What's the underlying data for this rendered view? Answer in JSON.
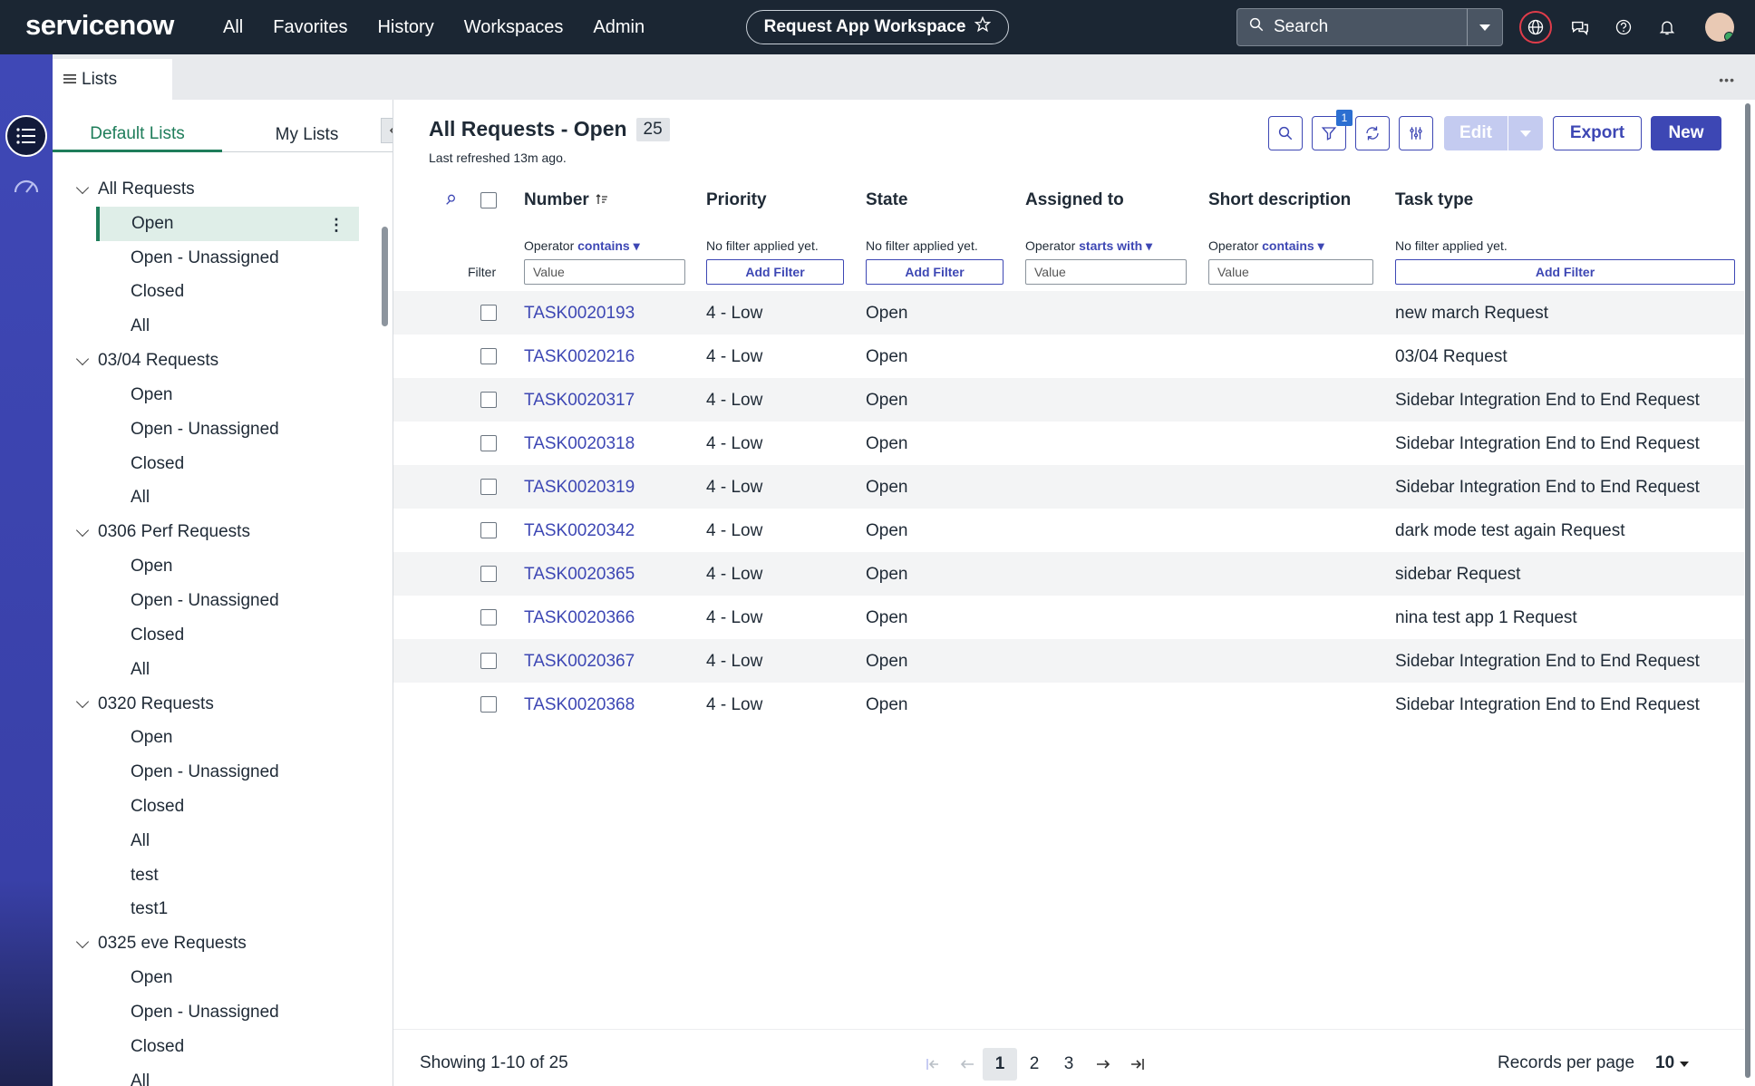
{
  "topbar": {
    "logo": "servicenow",
    "nav": [
      "All",
      "Favorites",
      "History",
      "Workspaces",
      "Admin"
    ],
    "workspace_title": "Request App Workspace",
    "search_placeholder": "Search"
  },
  "tabstrip": {
    "tab_label": "Lists"
  },
  "sidebar": {
    "tabs": [
      "Default Lists",
      "My Lists"
    ],
    "groups": [
      {
        "title": "All Requests",
        "items": [
          "Open",
          "Open - Unassigned",
          "Closed",
          "All"
        ],
        "selected": 0
      },
      {
        "title": "03/04 Requests",
        "items": [
          "Open",
          "Open - Unassigned",
          "Closed",
          "All"
        ]
      },
      {
        "title": "0306 Perf Requests",
        "items": [
          "Open",
          "Open - Unassigned",
          "Closed",
          "All"
        ]
      },
      {
        "title": "0320 Requests",
        "items": [
          "Open",
          "Open - Unassigned",
          "Closed",
          "All",
          "test",
          "test1"
        ]
      },
      {
        "title": "0325 eve Requests",
        "items": [
          "Open",
          "Open - Unassigned",
          "Closed",
          "All"
        ]
      }
    ]
  },
  "list": {
    "title": "All Requests - Open",
    "count": "25",
    "refreshed": "Last refreshed 13m ago.",
    "filter_badge": "1",
    "buttons": {
      "edit": "Edit",
      "export": "Export",
      "new": "New"
    },
    "columns": [
      "Number",
      "Priority",
      "State",
      "Assigned to",
      "Short description",
      "Task type"
    ],
    "filter_label": "Filter",
    "operators": {
      "number": {
        "prefix": "Operator",
        "op": "contains"
      },
      "assigned": {
        "prefix": "Operator",
        "op": "starts with"
      },
      "short_desc": {
        "prefix": "Operator",
        "op": "contains"
      }
    },
    "no_filter": "No filter applied yet.",
    "value_placeholder": "Value",
    "add_filter": "Add Filter",
    "rows": [
      {
        "number": "TASK0020193",
        "priority": "4 - Low",
        "state": "Open",
        "task_type": "new march Request"
      },
      {
        "number": "TASK0020216",
        "priority": "4 - Low",
        "state": "Open",
        "task_type": "03/04 Request"
      },
      {
        "number": "TASK0020317",
        "priority": "4 - Low",
        "state": "Open",
        "task_type": "Sidebar Integration End to End Request"
      },
      {
        "number": "TASK0020318",
        "priority": "4 - Low",
        "state": "Open",
        "task_type": "Sidebar Integration End to End Request"
      },
      {
        "number": "TASK0020319",
        "priority": "4 - Low",
        "state": "Open",
        "task_type": "Sidebar Integration End to End Request"
      },
      {
        "number": "TASK0020342",
        "priority": "4 - Low",
        "state": "Open",
        "task_type": "dark mode test again Request"
      },
      {
        "number": "TASK0020365",
        "priority": "4 - Low",
        "state": "Open",
        "task_type": "sidebar Request"
      },
      {
        "number": "TASK0020366",
        "priority": "4 - Low",
        "state": "Open",
        "task_type": "nina test app 1 Request"
      },
      {
        "number": "TASK0020367",
        "priority": "4 - Low",
        "state": "Open",
        "task_type": "Sidebar Integration End to End Request"
      },
      {
        "number": "TASK0020368",
        "priority": "4 - Low",
        "state": "Open",
        "task_type": "Sidebar Integration End to End Request"
      }
    ]
  },
  "footer": {
    "showing": "Showing 1-10 of 25",
    "pages": [
      "1",
      "2",
      "3"
    ],
    "current_page": "1",
    "records_label": "Records per page",
    "records_value": "10"
  },
  "colors": {
    "accent": "#3d47b4",
    "brand_green": "#1e7d5a",
    "topbar": "#1b2633"
  },
  "icons": [
    "search-icon",
    "star-icon",
    "globe-icon",
    "chat-icon",
    "help-icon",
    "bell-icon",
    "list-menu-icon",
    "gauge-icon",
    "filter-icon",
    "refresh-icon",
    "settings-icon",
    "sort-icon"
  ]
}
